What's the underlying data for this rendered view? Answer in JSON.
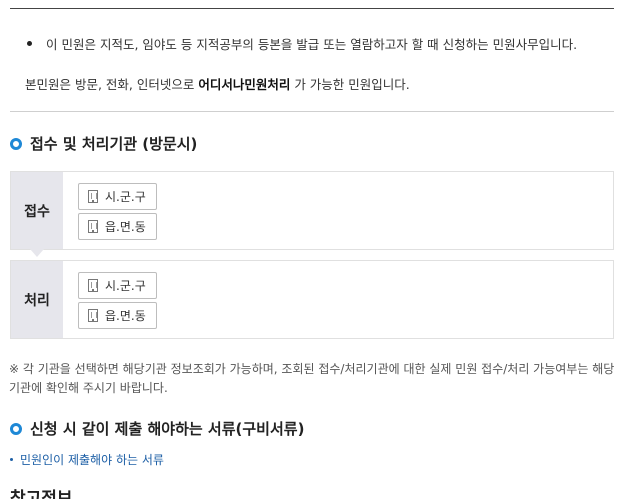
{
  "intro": {
    "bullet_text": "이 민원은 지적도, 임야도 등 지적공부의 등본을 발급 또는 열람하고자 할 때 신청하는 민원사무입니다.",
    "availability_prefix": "본민원은 방문, 전화, 인터넷으로 ",
    "availability_strong": "어디서나민원처리",
    "availability_suffix": " 가 가능한 민원입니다."
  },
  "reception_section": {
    "title": "접수 및 처리기관 (방문시)",
    "boxes": [
      {
        "label": "접수",
        "chips": [
          "시.군.구",
          "읍.면.동"
        ]
      },
      {
        "label": "처리",
        "chips": [
          "시.군.구",
          "읍.면.동"
        ]
      }
    ],
    "note": "※ 각 기관을 선택하면 해당기관 정보조회가 가능하며, 조회된 접수/처리기관에 대한 실제 민원 접수/처리 가능여부는 해당기관에 확인해 주시기 바랍니다."
  },
  "documents_section": {
    "title": "신청 시 같이 제출 해야하는 서류(구비서류)",
    "link_text": "민원인이 제출해야 하는 서류"
  },
  "next_heading": "참고정보",
  "colors": {
    "accent": "#1e88d6",
    "link": "#1d5fa6",
    "side_bg": "#e6e6ec"
  },
  "icons": {
    "section": "ring-icon",
    "chip": "building-icon",
    "list": "bullet-dot"
  }
}
